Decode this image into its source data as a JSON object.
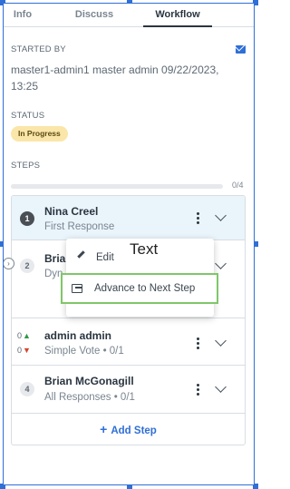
{
  "tabs": [
    {
      "label": "Info"
    },
    {
      "label": "Discuss"
    },
    {
      "label": "Workflow",
      "active": true
    }
  ],
  "started_by": {
    "label": "STARTED BY",
    "text": "master1-admin1 master admin 09/22/2023, 13:25",
    "icon": "mail-icon"
  },
  "status": {
    "label": "STATUS",
    "value": "In Progress",
    "color": "#fbe6a9"
  },
  "steps_section": {
    "label": "STEPS",
    "progress_fraction": 0.0,
    "count": "0/4"
  },
  "steps": [
    {
      "number": "1",
      "name": "Nina Creel",
      "sub": "First Response"
    },
    {
      "number": "2",
      "name": "Bria",
      "sub": "Dyn"
    },
    {
      "up": "0",
      "down": "0",
      "name": "admin admin",
      "sub": "Simple Vote • 0/1"
    },
    {
      "number": "4",
      "name": "Brian McGonagill",
      "sub": "All Responses • 0/1"
    }
  ],
  "add_step_label": "Add Step",
  "menu": {
    "edit_label": "Edit",
    "text_label": "Text",
    "advance_label": "Advance to Next Step"
  },
  "colors": {
    "accent": "#2f6fd6",
    "highlight_row": "#eaf4fb",
    "advance_outline": "#7fc66a"
  }
}
